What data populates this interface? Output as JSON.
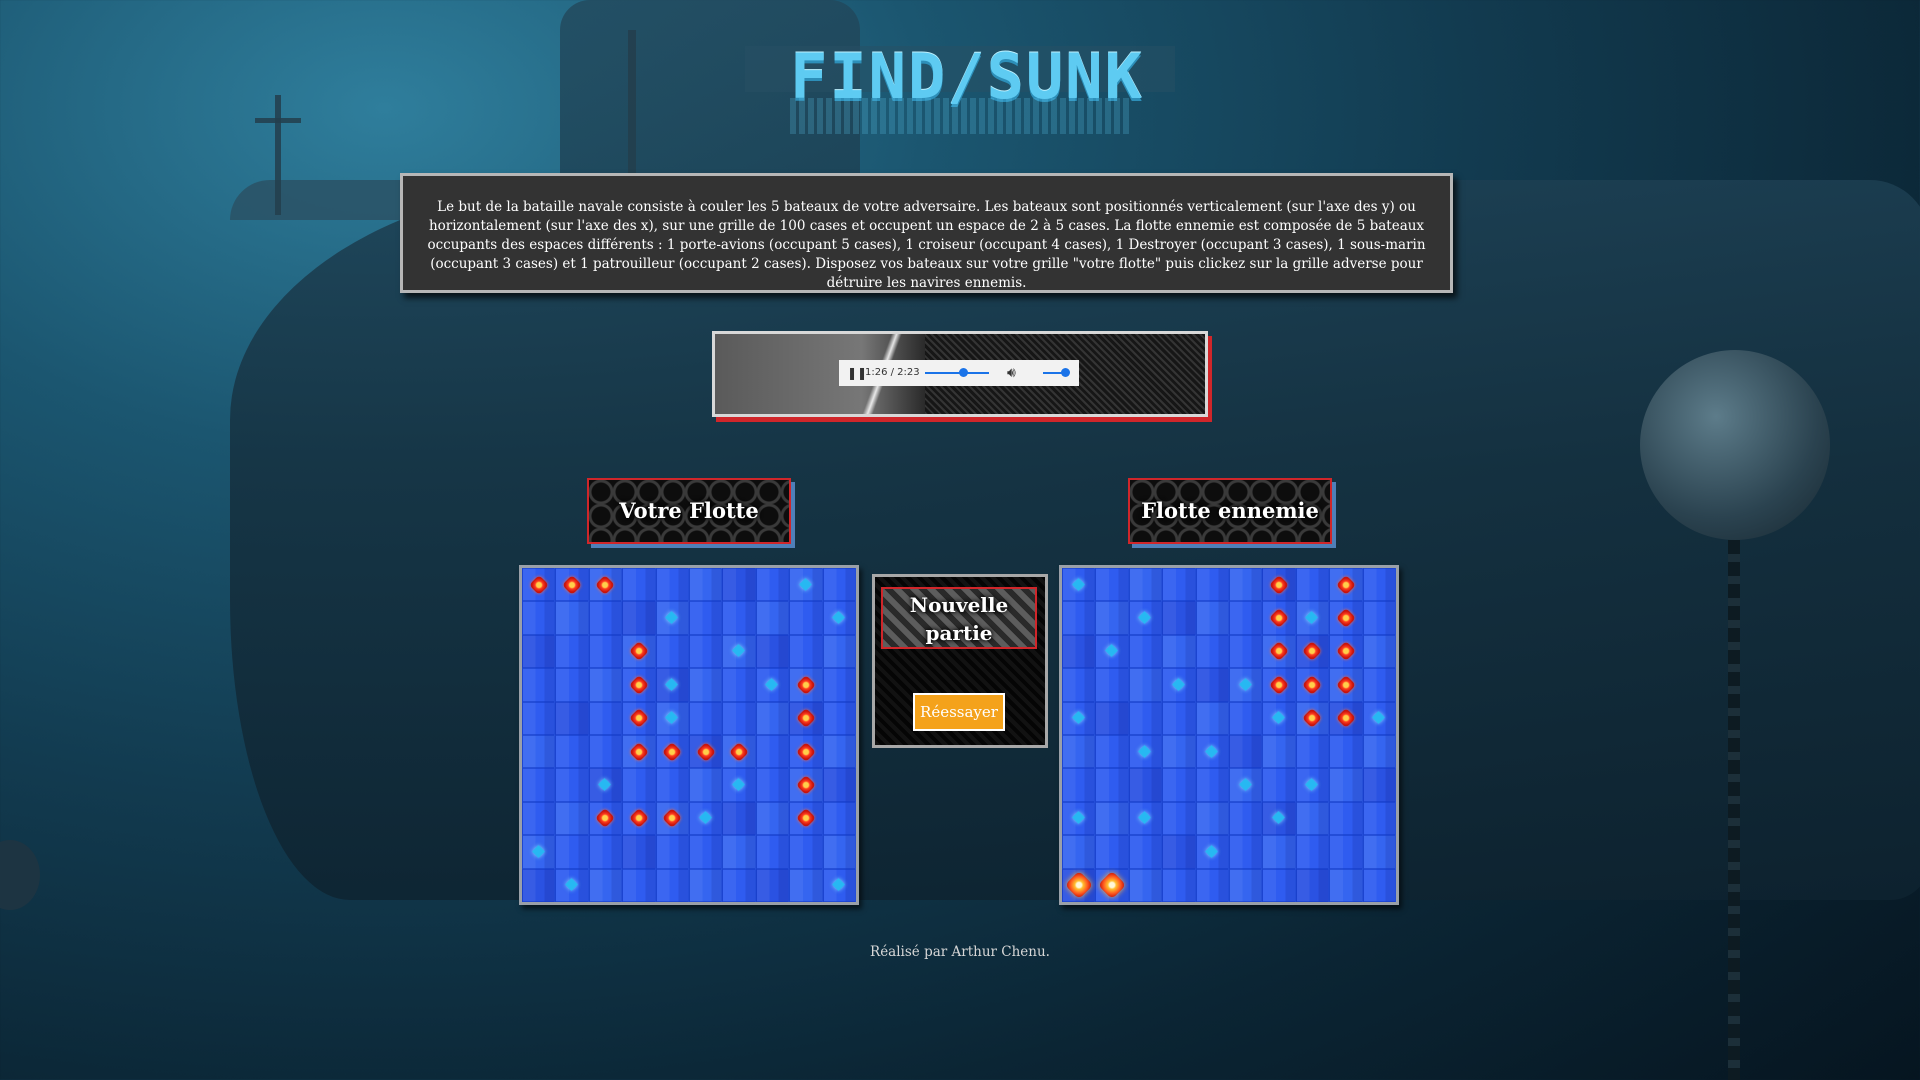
{
  "app": {
    "logo_text": "FIND/SUNK",
    "rules_text": "Le but de la bataille navale consiste à couler les 5 bateaux de votre adversaire. Les bateaux sont positionnés verticalement (sur l'axe des y) ou horizontalement (sur l'axe des x), sur une grille de 100 cases et occupent un espace de 2 à 5 cases. La flotte ennemie est composée de 5 bateaux occupants des espaces différents : 1 porte-avions (occupant 5 cases), 1 croiseur (occupant 4 cases), 1 Destroyer (occupant 3 cases), 1 sous-marin (occupant 3 cases) et 1 patrouilleur (occupant 2 cases). Disposez vos bateaux sur votre grille \"votre flotte\" puis clickez sur la grille adverse pour détruire les navires ennemis.",
    "footer": "Réalisé par Arthur Chenu."
  },
  "audio": {
    "time": "1:26 / 2:23",
    "progress": 0.6,
    "volume": 0.85,
    "pause_icon": "pause-icon",
    "volume_icon": "volume-icon"
  },
  "player_grid": {
    "label": "Votre Flotte",
    "ships": [
      [
        0,
        0
      ],
      [
        0,
        1
      ],
      [
        0,
        2
      ],
      [
        2,
        3
      ],
      [
        3,
        3
      ],
      [
        4,
        3
      ],
      [
        5,
        3
      ],
      [
        5,
        4
      ],
      [
        5,
        5
      ],
      [
        5,
        6
      ],
      [
        7,
        2
      ],
      [
        7,
        3
      ],
      [
        7,
        4
      ],
      [
        3,
        8
      ],
      [
        4,
        8
      ],
      [
        5,
        8
      ],
      [
        6,
        8
      ],
      [
        7,
        8
      ]
    ],
    "misses": [
      [
        0,
        8
      ],
      [
        1,
        4
      ],
      [
        1,
        9
      ],
      [
        2,
        6
      ],
      [
        3,
        4
      ],
      [
        3,
        7
      ],
      [
        4,
        4
      ],
      [
        6,
        2
      ],
      [
        6,
        6
      ],
      [
        7,
        5
      ],
      [
        8,
        0
      ],
      [
        9,
        1
      ],
      [
        9,
        9
      ]
    ],
    "hits": []
  },
  "enemy_grid": {
    "label": "Flotte ennemie",
    "ships": [
      [
        0,
        6
      ],
      [
        0,
        8
      ],
      [
        1,
        6
      ],
      [
        1,
        8
      ],
      [
        2,
        6
      ],
      [
        2,
        7
      ],
      [
        2,
        8
      ],
      [
        3,
        6
      ],
      [
        3,
        7
      ],
      [
        3,
        8
      ],
      [
        4,
        7
      ],
      [
        4,
        8
      ]
    ],
    "misses": [
      [
        0,
        0
      ],
      [
        1,
        2
      ],
      [
        1,
        7
      ],
      [
        2,
        1
      ],
      [
        3,
        3
      ],
      [
        3,
        5
      ],
      [
        4,
        0
      ],
      [
        4,
        6
      ],
      [
        4,
        9
      ],
      [
        5,
        2
      ],
      [
        5,
        4
      ],
      [
        6,
        5
      ],
      [
        6,
        7
      ],
      [
        7,
        0
      ],
      [
        7,
        2
      ],
      [
        7,
        6
      ],
      [
        8,
        4
      ]
    ],
    "hits": [
      [
        9,
        0
      ],
      [
        9,
        1
      ]
    ]
  },
  "controls": {
    "new_game_label": "Nouvelle partie",
    "retry_label": "Réessayer"
  }
}
